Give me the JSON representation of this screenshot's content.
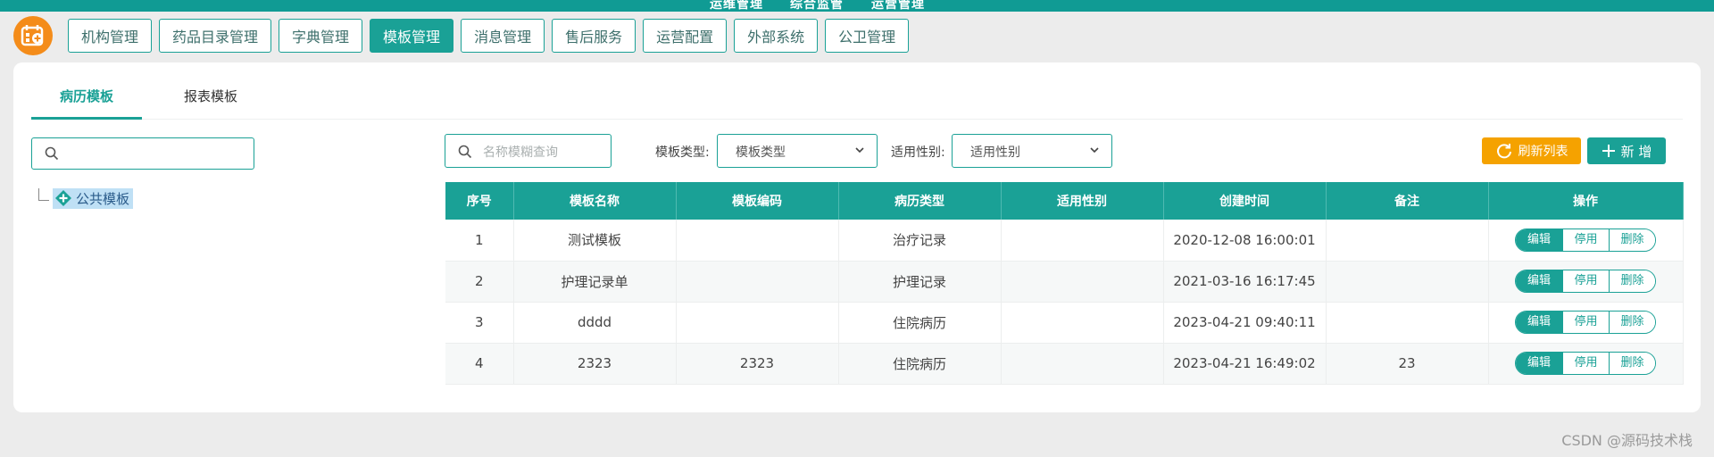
{
  "top_nav": [
    "运维管理",
    "综合监管",
    "运营管理"
  ],
  "submenu": [
    {
      "label": "机构管理",
      "active": false
    },
    {
      "label": "药品目录管理",
      "active": false
    },
    {
      "label": "字典管理",
      "active": false
    },
    {
      "label": "模板管理",
      "active": true
    },
    {
      "label": "消息管理",
      "active": false
    },
    {
      "label": "售后服务",
      "active": false
    },
    {
      "label": "运营配置",
      "active": false
    },
    {
      "label": "外部系统",
      "active": false
    },
    {
      "label": "公卫管理",
      "active": false
    }
  ],
  "tabs": [
    {
      "label": "病历模板",
      "active": true
    },
    {
      "label": "报表模板",
      "active": false
    }
  ],
  "tree": {
    "search_placeholder": "",
    "node_label": "公共模板"
  },
  "toolbar": {
    "name_placeholder": "名称模糊查询",
    "type_label": "模板类型:",
    "type_value": "模板类型",
    "gender_label": "适用性别:",
    "gender_value": "适用性别",
    "refresh_label": "刷新列表",
    "add_label": "新 增"
  },
  "table": {
    "columns": [
      "序号",
      "模板名称",
      "模板编码",
      "病历类型",
      "适用性别",
      "创建时间",
      "备注",
      "操作"
    ],
    "rows": [
      [
        "1",
        "测试模板",
        "",
        "治疗记录",
        "",
        "2020-12-08 16:00:01",
        ""
      ],
      [
        "2",
        "护理记录单",
        "",
        "护理记录",
        "",
        "2021-03-16 16:17:45",
        ""
      ],
      [
        "3",
        "dddd",
        "",
        "住院病历",
        "",
        "2023-04-21 09:40:11",
        ""
      ],
      [
        "4",
        "2323",
        "2323",
        "住院病历",
        "",
        "2023-04-21 16:49:02",
        "23"
      ]
    ],
    "actions": [
      "编辑",
      "停用",
      "删除"
    ]
  },
  "watermark": "CSDN @源码技术栈",
  "colors": {
    "accent": "#1aa196",
    "warning": "#f5a200",
    "logo": "#f48c1a"
  }
}
